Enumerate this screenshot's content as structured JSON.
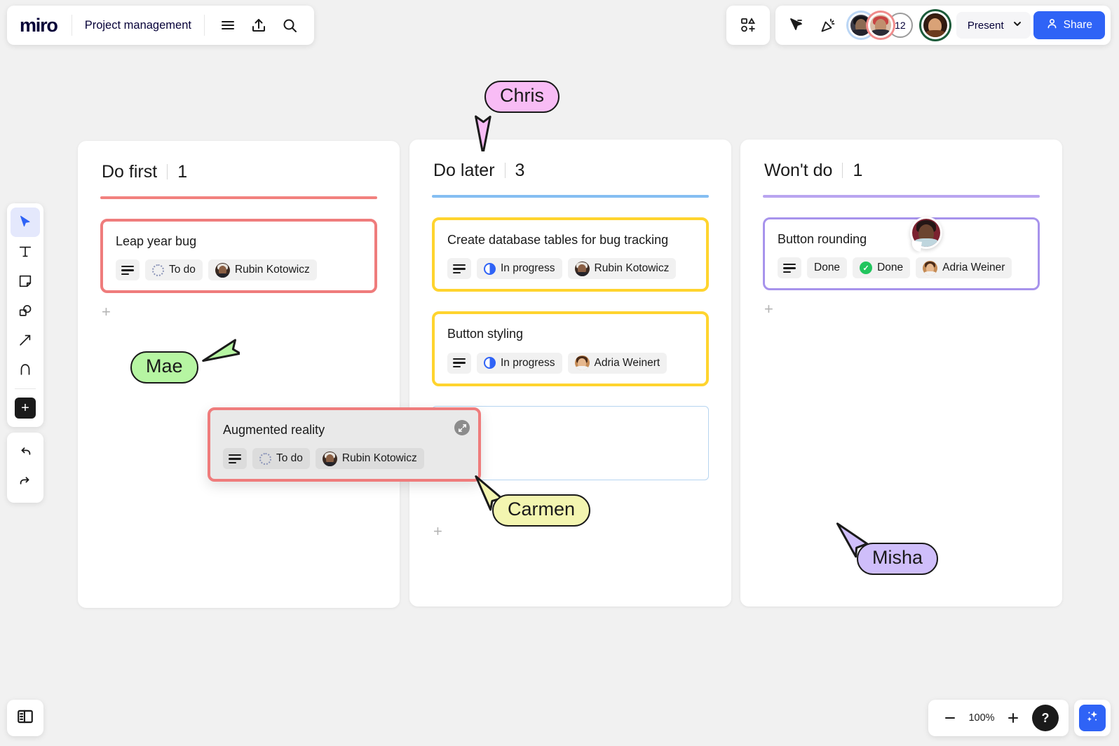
{
  "app": {
    "logo": "miro",
    "board_title": "Project management"
  },
  "topbar": {
    "menu_icon": "hamburger-menu-icon",
    "upload_icon": "upload-icon",
    "search_icon": "search-icon",
    "templates_icon": "shapes-templates-icon",
    "cursor_share_icon": "cursor-pointer-icon",
    "celebrate_icon": "party-popper-icon",
    "collaborator_count": "12",
    "present_label": "Present",
    "present_chevron": "chevron-down-icon",
    "share_label": "Share",
    "share_icon": "person-icon"
  },
  "left_toolbar": {
    "tools": [
      {
        "name": "select",
        "icon": "cursor-arrow-icon",
        "active": true
      },
      {
        "name": "text",
        "icon": "text-T-icon",
        "active": false
      },
      {
        "name": "sticky-note",
        "icon": "sticky-note-icon",
        "active": false
      },
      {
        "name": "shapes",
        "icon": "shapes-icon",
        "active": false
      },
      {
        "name": "connector",
        "icon": "arrow-connector-icon",
        "active": false
      },
      {
        "name": "pen",
        "icon": "pen-draw-icon",
        "active": false
      },
      {
        "name": "more-apps",
        "icon": "plus-icon",
        "active": false
      }
    ],
    "undo_icon": "undo-arrow-icon",
    "redo_icon": "redo-arrow-icon"
  },
  "board": {
    "columns": [
      {
        "title": "Do first",
        "count": "1",
        "accent": "#F2817E",
        "add_label": "+",
        "cards": [
          {
            "title": "Leap year bug",
            "border": "#EF7C7C",
            "description_icon": "description-lines-icon",
            "status": {
              "label": "To do",
              "icon": "dotted-circle-icon"
            },
            "assignee": "Rubin Kotowicz"
          }
        ]
      },
      {
        "title": "Do later",
        "count": "3",
        "accent": "#85BEF2",
        "add_label": "+",
        "cards": [
          {
            "title": "Create database tables for bug tracking",
            "border": "#FFD42E",
            "description_icon": "description-lines-icon",
            "status": {
              "label": "In progress",
              "icon": "half-filled-circle-icon"
            },
            "assignee": "Rubin Kotowicz"
          },
          {
            "title": "Button styling",
            "border": "#FFD42E",
            "description_icon": "description-lines-icon",
            "status": {
              "label": "In progress",
              "icon": "half-filled-circle-icon"
            },
            "assignee": "Adria Weinert"
          }
        ],
        "drop_placeholder": true
      },
      {
        "title": "Won't do",
        "count": "1",
        "accent": "#B9A5F0",
        "add_label": "+",
        "cards": [
          {
            "title": "Button rounding",
            "border": "#A793EC",
            "description_icon": "description-lines-icon",
            "extra_chip": "Done",
            "status": {
              "label": "Done",
              "icon": "green-check-circle-icon"
            },
            "assignee": "Adria Weiner"
          }
        ]
      }
    ],
    "dragged_card": {
      "title": "Augmented reality",
      "border": "#EF7C7C",
      "description_icon": "description-lines-icon",
      "status": {
        "label": "To do",
        "icon": "dotted-circle-icon"
      },
      "assignee": "Rubin Kotowicz",
      "expand_icon": "expand-diagonal-icon"
    },
    "cursors": [
      {
        "name": "Chris",
        "color": "#F8BCF5"
      },
      {
        "name": "Mae",
        "color": "#B6F5A2"
      },
      {
        "name": "Carmen",
        "color": "#F3F5B0"
      },
      {
        "name": "Misha",
        "color": "#CFBEFA"
      }
    ]
  },
  "bottom": {
    "panel_toggle_icon": "side-panel-icon",
    "zoom_out_icon": "minus-icon",
    "zoom_level": "100%",
    "zoom_in_icon": "plus-icon",
    "help_label": "?",
    "ai_icon": "sparkles-icon"
  }
}
